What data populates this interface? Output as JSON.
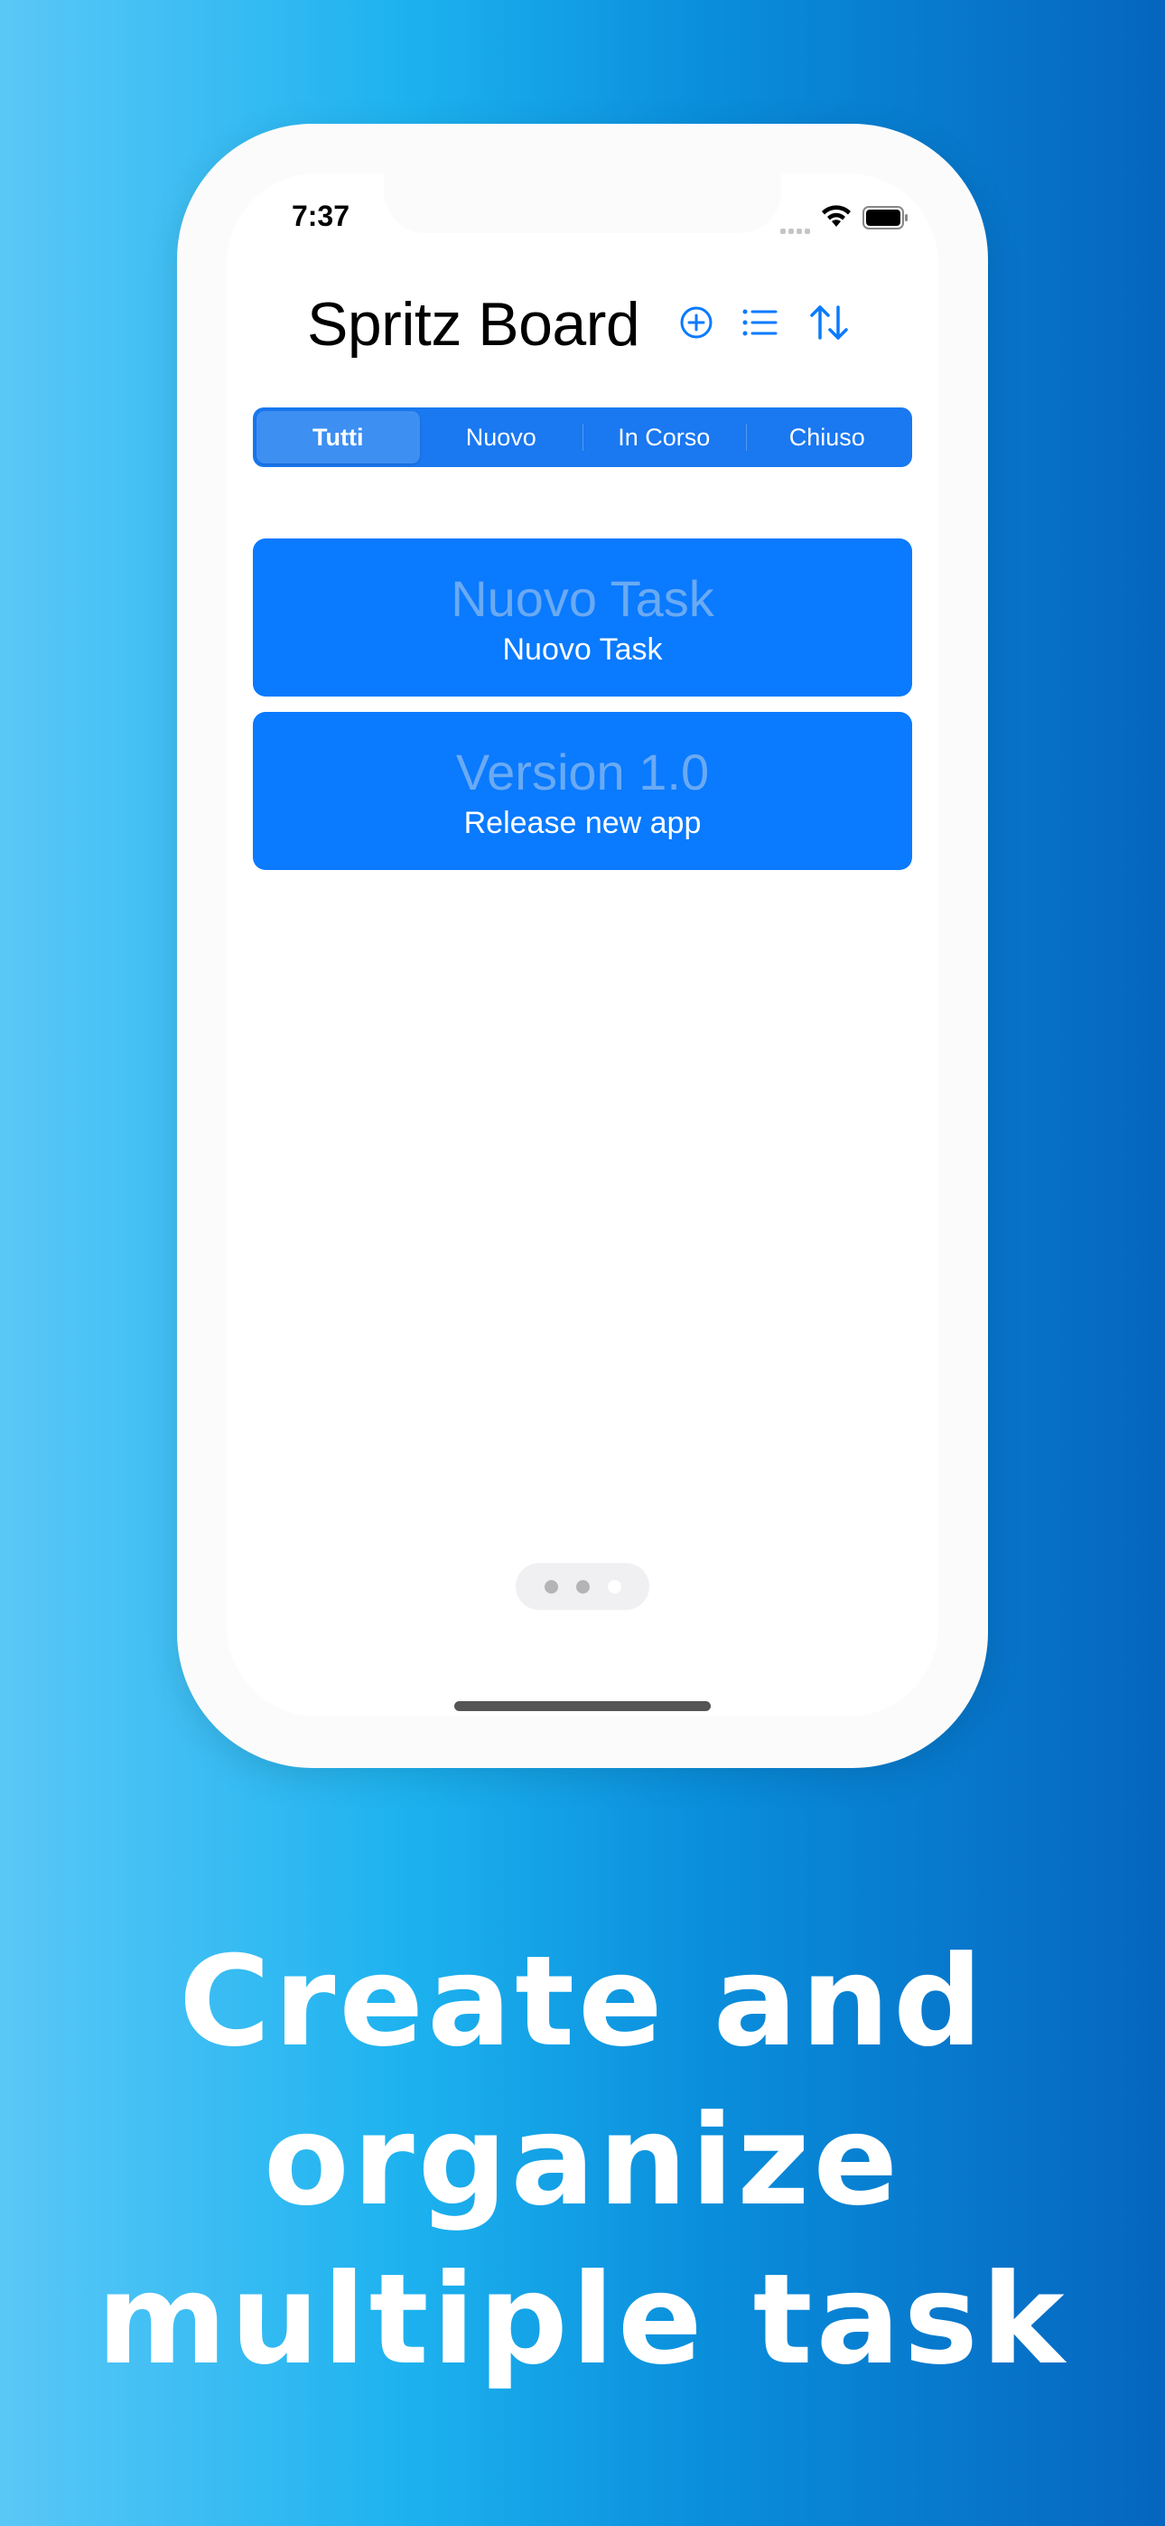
{
  "status_bar": {
    "time": "7:37"
  },
  "header": {
    "title": "Spritz Board",
    "icons": [
      "plus-circle-icon",
      "list-icon",
      "sort-arrows-icon"
    ]
  },
  "segments": [
    {
      "label": "Tutti",
      "selected": true
    },
    {
      "label": "Nuovo",
      "selected": false
    },
    {
      "label": "In Corso",
      "selected": false
    },
    {
      "label": "Chiuso",
      "selected": false
    }
  ],
  "tasks": [
    {
      "title": "Nuovo Task",
      "description": "Nuovo Task"
    },
    {
      "title": "Version 1.0",
      "description": "Release new app"
    }
  ],
  "page_indicator": {
    "count": 3,
    "current": 3
  },
  "caption": {
    "lines": [
      "Create and",
      "organize",
      "multiple task"
    ]
  },
  "colors": {
    "accent": "#0A7AFF",
    "segment_bg": "#1A78F0",
    "card_title": "#6AAAF3",
    "background_left": "#5AC8F7",
    "background_right": "#0565BF"
  }
}
